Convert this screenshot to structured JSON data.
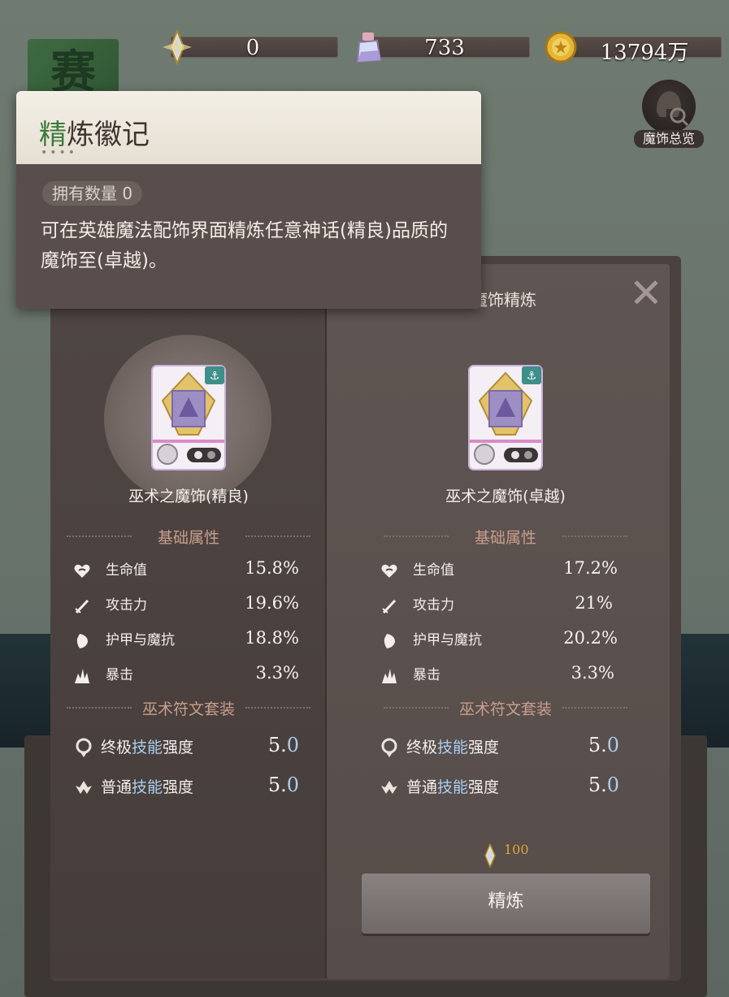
{
  "currencies": [
    {
      "icon": "crystal-icon",
      "value": "0"
    },
    {
      "icon": "potion-icon",
      "value": "733"
    },
    {
      "icon": "gold-coin-icon",
      "value": "13794万"
    }
  ],
  "background_badge": "赛",
  "overview_label": "魔饰总览",
  "tooltip": {
    "title_first_char": "精",
    "title_rest": "炼徽记",
    "dots": "••••",
    "count_label": "拥有数量 0",
    "description": "可在英雄魔法配饰界面精炼任意神话(精良)品质的魔饰至(卓越)。"
  },
  "panel": {
    "title": "魔饰精炼",
    "close_glyph": "✕",
    "base_attr_label": "基础属性",
    "set_label": "巫术符文套装",
    "left": {
      "name": "巫术之魔饰(精良)",
      "stats": [
        {
          "icon": "heart-icon",
          "label": "生命值",
          "value": "15.8%"
        },
        {
          "icon": "sword-icon",
          "label": "攻击力",
          "value": "19.6%"
        },
        {
          "icon": "shield-icon",
          "label": "护甲与魔抗",
          "value": "18.8%"
        },
        {
          "icon": "crit-icon",
          "label": "暴击",
          "value": "3.3%"
        }
      ],
      "sets": [
        {
          "icon": "ultimate-icon",
          "pre": "终极",
          "hl": "技能",
          "post": "强度",
          "int": "5.",
          "dec": "0"
        },
        {
          "icon": "normal-skill-icon",
          "pre": "普通",
          "hl": "技能",
          "post": "强度",
          "int": "5.",
          "dec": "0"
        }
      ]
    },
    "right": {
      "name": "巫术之魔饰(卓越)",
      "stats": [
        {
          "icon": "heart-icon",
          "label": "生命值",
          "value": "17.2%"
        },
        {
          "icon": "sword-icon",
          "label": "攻击力",
          "value": "21%"
        },
        {
          "icon": "shield-icon",
          "label": "护甲与魔抗",
          "value": "20.2%"
        },
        {
          "icon": "crit-icon",
          "label": "暴击",
          "value": "3.3%"
        }
      ],
      "sets": [
        {
          "icon": "ultimate-icon",
          "pre": "终极",
          "hl": "技能",
          "post": "强度",
          "int": "5.",
          "dec": "0"
        },
        {
          "icon": "normal-skill-icon",
          "pre": "普通",
          "hl": "技能",
          "post": "强度",
          "int": "5.",
          "dec": "0"
        }
      ]
    },
    "cost": "100",
    "refine_button": "精炼"
  },
  "colors": {
    "accent_blue": "#a9cdf0",
    "section_label": "#c89e8c",
    "cost_orange": "#e3a23d",
    "title_green": "#3d7a3c"
  }
}
